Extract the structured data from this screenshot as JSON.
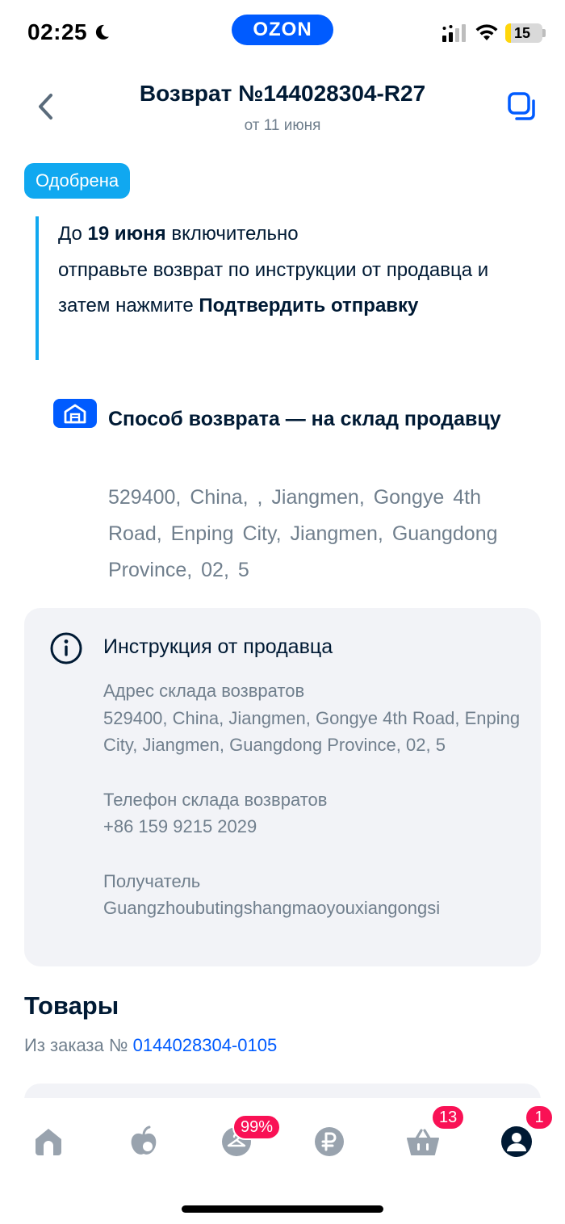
{
  "status_bar": {
    "time": "02:25",
    "app_logo": "OZON",
    "battery_level": "15",
    "battery_fraction": 0.15,
    "icons": [
      "moon-icon",
      "signal-icon",
      "wifi-icon",
      "battery-icon"
    ]
  },
  "header": {
    "title": "Возврат №144028304-R27",
    "subtitle": "от 11 июня",
    "back_icon": "chevron-left-icon",
    "action_icon": "copy-icon"
  },
  "status_badge": "Одобрена",
  "notice": {
    "part1": "До ",
    "date_bold": "19 июня",
    "part2": " включительно",
    "part3": "отправьте возврат по инструкции от продавца и затем нажмите ",
    "action_bold": "Подтвердить отправку"
  },
  "return_method": {
    "icon": "warehouse-icon",
    "title": "Способ возврата — на склад продавцу",
    "address": "529400, China, , Jiangmen, Gongye 4th Road, Enping City, Jiangmen, Guangdong Province, 02, 5"
  },
  "instruction": {
    "icon": "info-icon",
    "title": "Инструкция от продавца",
    "address_label": "Адрес склада возвратов",
    "address_value": "529400, China, Jiangmen, Gongye 4th Road, Enping City, Jiangmen, Guangdong Province, 02, 5",
    "phone_label": "Телефон склада возвратов",
    "phone_value": "+86 159 9215 2029",
    "recipient_label": "Получатель",
    "recipient_value": "Guangzhoubutingshangmaoyouxiangongsi"
  },
  "goods": {
    "title": "Товары",
    "order_prefix": "Из заказа № ",
    "order_number": "0144028304-0105"
  },
  "tab_bar": {
    "tabs": [
      {
        "icon": "home-icon"
      },
      {
        "icon": "fresh-icon"
      },
      {
        "icon": "clothes-hanger-icon",
        "badge": "99%"
      },
      {
        "icon": "ruble-icon"
      },
      {
        "icon": "cart-icon",
        "badge": "13"
      },
      {
        "icon": "profile-icon",
        "badge": "1"
      }
    ]
  },
  "colors": {
    "brand_blue": "#005bff",
    "status_blue": "#10a8f0",
    "badge_red": "#f91155",
    "text_primary": "#001a34",
    "text_secondary": "#707f8d",
    "card_bg": "#f2f3f7"
  }
}
